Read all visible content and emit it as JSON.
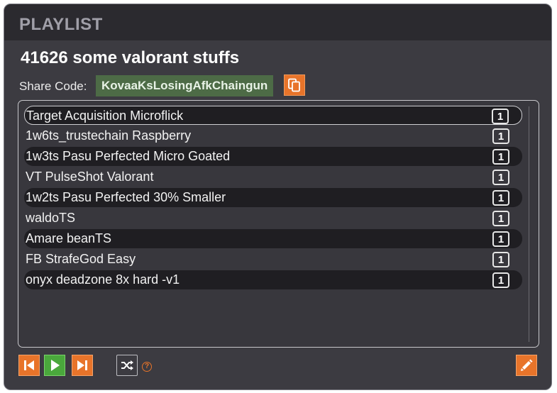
{
  "header": {
    "title": "PLAYLIST"
  },
  "playlist": {
    "name": "41626 some valorant stuffs",
    "share_label": "Share Code:",
    "share_code": "KovaaKsLosingAfkChaingun"
  },
  "scenarios": [
    {
      "name": "Target Acquisition Microflick",
      "count": "1"
    },
    {
      "name": "1w6ts_trustechain Raspberry",
      "count": "1"
    },
    {
      "name": "1w3ts Pasu Perfected Micro Goated",
      "count": "1"
    },
    {
      "name": "VT PulseShot Valorant",
      "count": "1"
    },
    {
      "name": "1w2ts Pasu Perfected 30% Smaller",
      "count": "1"
    },
    {
      "name": "waldoTS",
      "count": "1"
    },
    {
      "name": "Amare beanTS",
      "count": "1"
    },
    {
      "name": "FB StrafeGod Easy",
      "count": "1"
    },
    {
      "name": "onyx deadzone 8x hard -v1",
      "count": "1"
    }
  ],
  "controls": {
    "help_label": "?",
    "icons": [
      "skip-previous-icon",
      "play-icon",
      "skip-next-icon",
      "shuffle-icon",
      "help-icon",
      "edit-pencil-icon",
      "copy-icon"
    ]
  },
  "colors": {
    "accent_orange": "#e8742a",
    "play_green": "#4aa83c",
    "share_code_bg": "#4d6b46",
    "panel_bg": "#3c3b41",
    "header_bg": "#2b2a2f"
  }
}
